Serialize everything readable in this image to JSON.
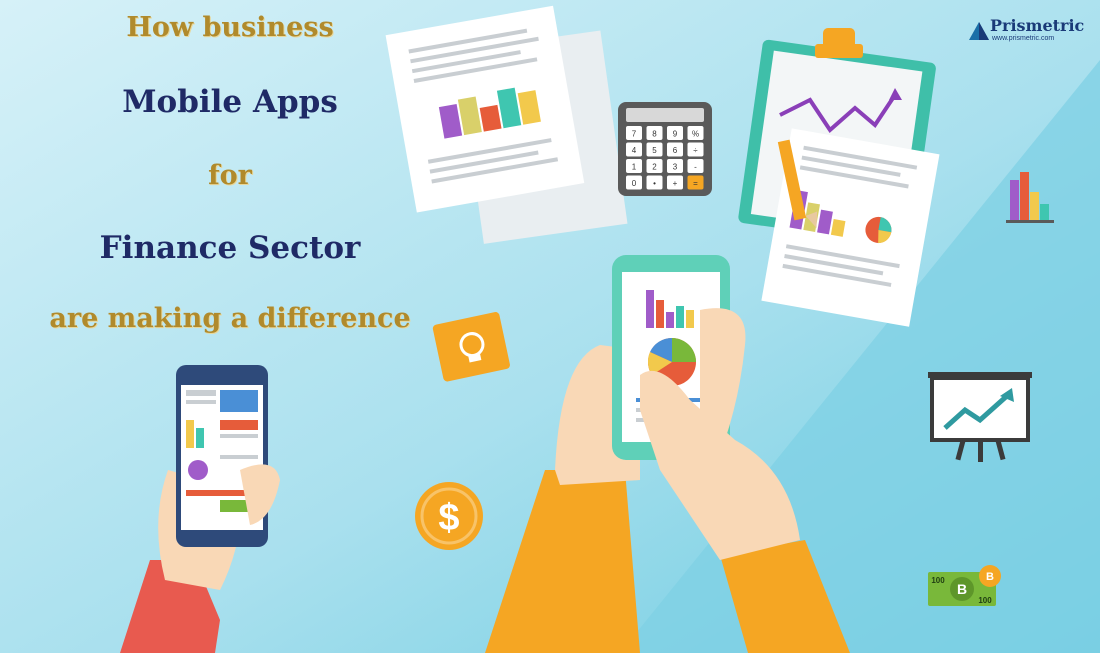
{
  "headline": {
    "line1": "How business",
    "line2": "Mobile Apps",
    "line3": "for",
    "line4": "Finance Sector",
    "line5": "are making a difference"
  },
  "logo": {
    "brand": "Prismetric",
    "url": "www.prismetric.com"
  },
  "calculator": {
    "keys": [
      "7",
      "8",
      "9",
      "%",
      "4",
      "5",
      "6",
      "÷",
      "1",
      "2",
      "3",
      "-",
      "0",
      "•",
      "+",
      "="
    ]
  },
  "money": {
    "denomination": "100",
    "coin_symbol": "$",
    "crypto_symbol": "B"
  },
  "colors": {
    "sky_top": "#cfeef7",
    "sky_bottom": "#5fc6df",
    "gold_text": "#b08a2c",
    "navy_text": "#1f2a66",
    "sleeve_orange": "#f5a623",
    "phone_teal": "#5fd0b8",
    "phone_navy": "#2e4a7a"
  }
}
